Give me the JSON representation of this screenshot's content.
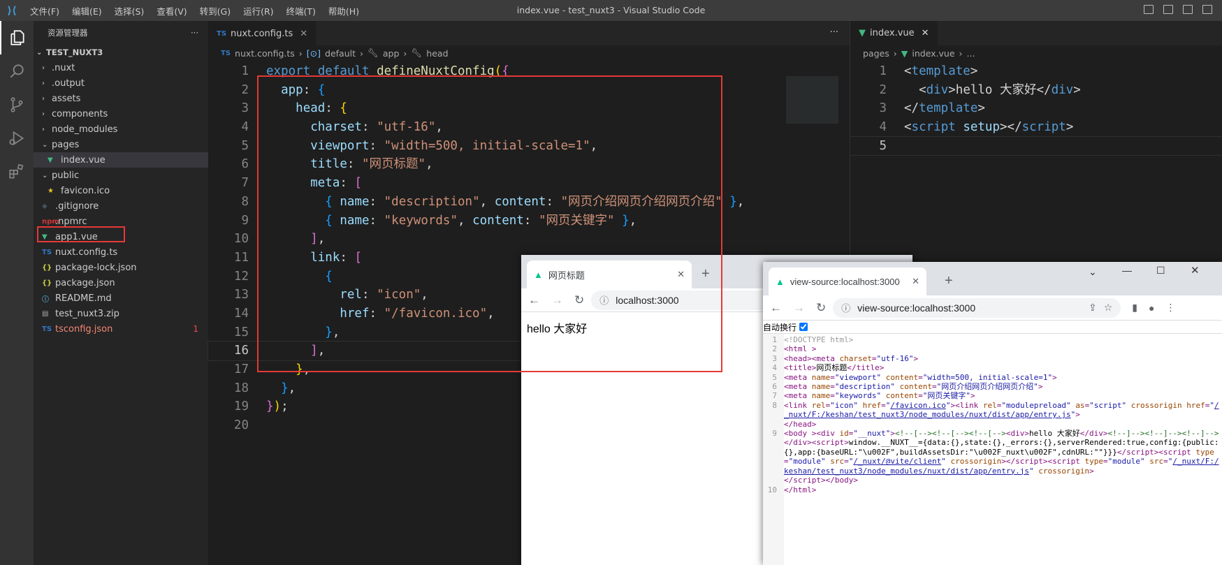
{
  "titlebar": {
    "menus": [
      "文件(F)",
      "编辑(E)",
      "选择(S)",
      "查看(V)",
      "转到(G)",
      "运行(R)",
      "终端(T)",
      "帮助(H)"
    ],
    "title": "index.vue - test_nuxt3 - Visual Studio Code"
  },
  "activity_icons": [
    "explorer-icon",
    "search-icon",
    "source-control-icon",
    "run-debug-icon",
    "extensions-icon"
  ],
  "sidebar": {
    "header": "资源管理器",
    "more": "···",
    "root": "TEST_NUXT3",
    "items": [
      {
        "label": ".nuxt",
        "type": "folder",
        "depth": 1
      },
      {
        "label": ".output",
        "type": "folder",
        "depth": 1
      },
      {
        "label": "assets",
        "type": "folder",
        "depth": 1
      },
      {
        "label": "components",
        "type": "folder",
        "depth": 1
      },
      {
        "label": "node_modules",
        "type": "folder",
        "depth": 1
      },
      {
        "label": "pages",
        "type": "folder-open",
        "depth": 1
      },
      {
        "label": "index.vue",
        "type": "vue",
        "depth": 2,
        "selected": true
      },
      {
        "label": "public",
        "type": "folder-open",
        "depth": 1
      },
      {
        "label": "favicon.ico",
        "type": "star",
        "depth": 2
      },
      {
        "label": ".gitignore",
        "type": "git",
        "depth": 1
      },
      {
        "label": ".npmrc",
        "type": "npm",
        "depth": 1
      },
      {
        "label": "app1.vue",
        "type": "vue",
        "depth": 1
      },
      {
        "label": "nuxt.config.ts",
        "type": "ts",
        "depth": 1,
        "boxed": true
      },
      {
        "label": "package-lock.json",
        "type": "json",
        "depth": 1
      },
      {
        "label": "package.json",
        "type": "json",
        "depth": 1
      },
      {
        "label": "README.md",
        "type": "info",
        "depth": 1
      },
      {
        "label": "test_nuxt3.zip",
        "type": "zip",
        "depth": 1
      },
      {
        "label": "tsconfig.json",
        "type": "ts",
        "depth": 1,
        "error": true,
        "badge": "1"
      }
    ]
  },
  "editor1": {
    "tab": "nuxt.config.ts",
    "tab_icon": "TS",
    "more": "···",
    "breadcrumb": [
      "nuxt.config.ts",
      "default",
      "app",
      "head"
    ],
    "current_line": 16
  },
  "editor2": {
    "tab": "index.vue",
    "breadcrumb": [
      "pages",
      "index.vue",
      "..."
    ],
    "current_line": 5
  },
  "browser1": {
    "tab_title": "网页标题",
    "url": "localhost:3000",
    "content": "hello 大家好"
  },
  "browser2": {
    "tab_title": "view-source:localhost:3000",
    "url": "view-source:localhost:3000",
    "wrap_label": "自动换行",
    "wrap_checked": true
  },
  "colors": {
    "accent": "#007acc",
    "highlight": "#e53935"
  }
}
